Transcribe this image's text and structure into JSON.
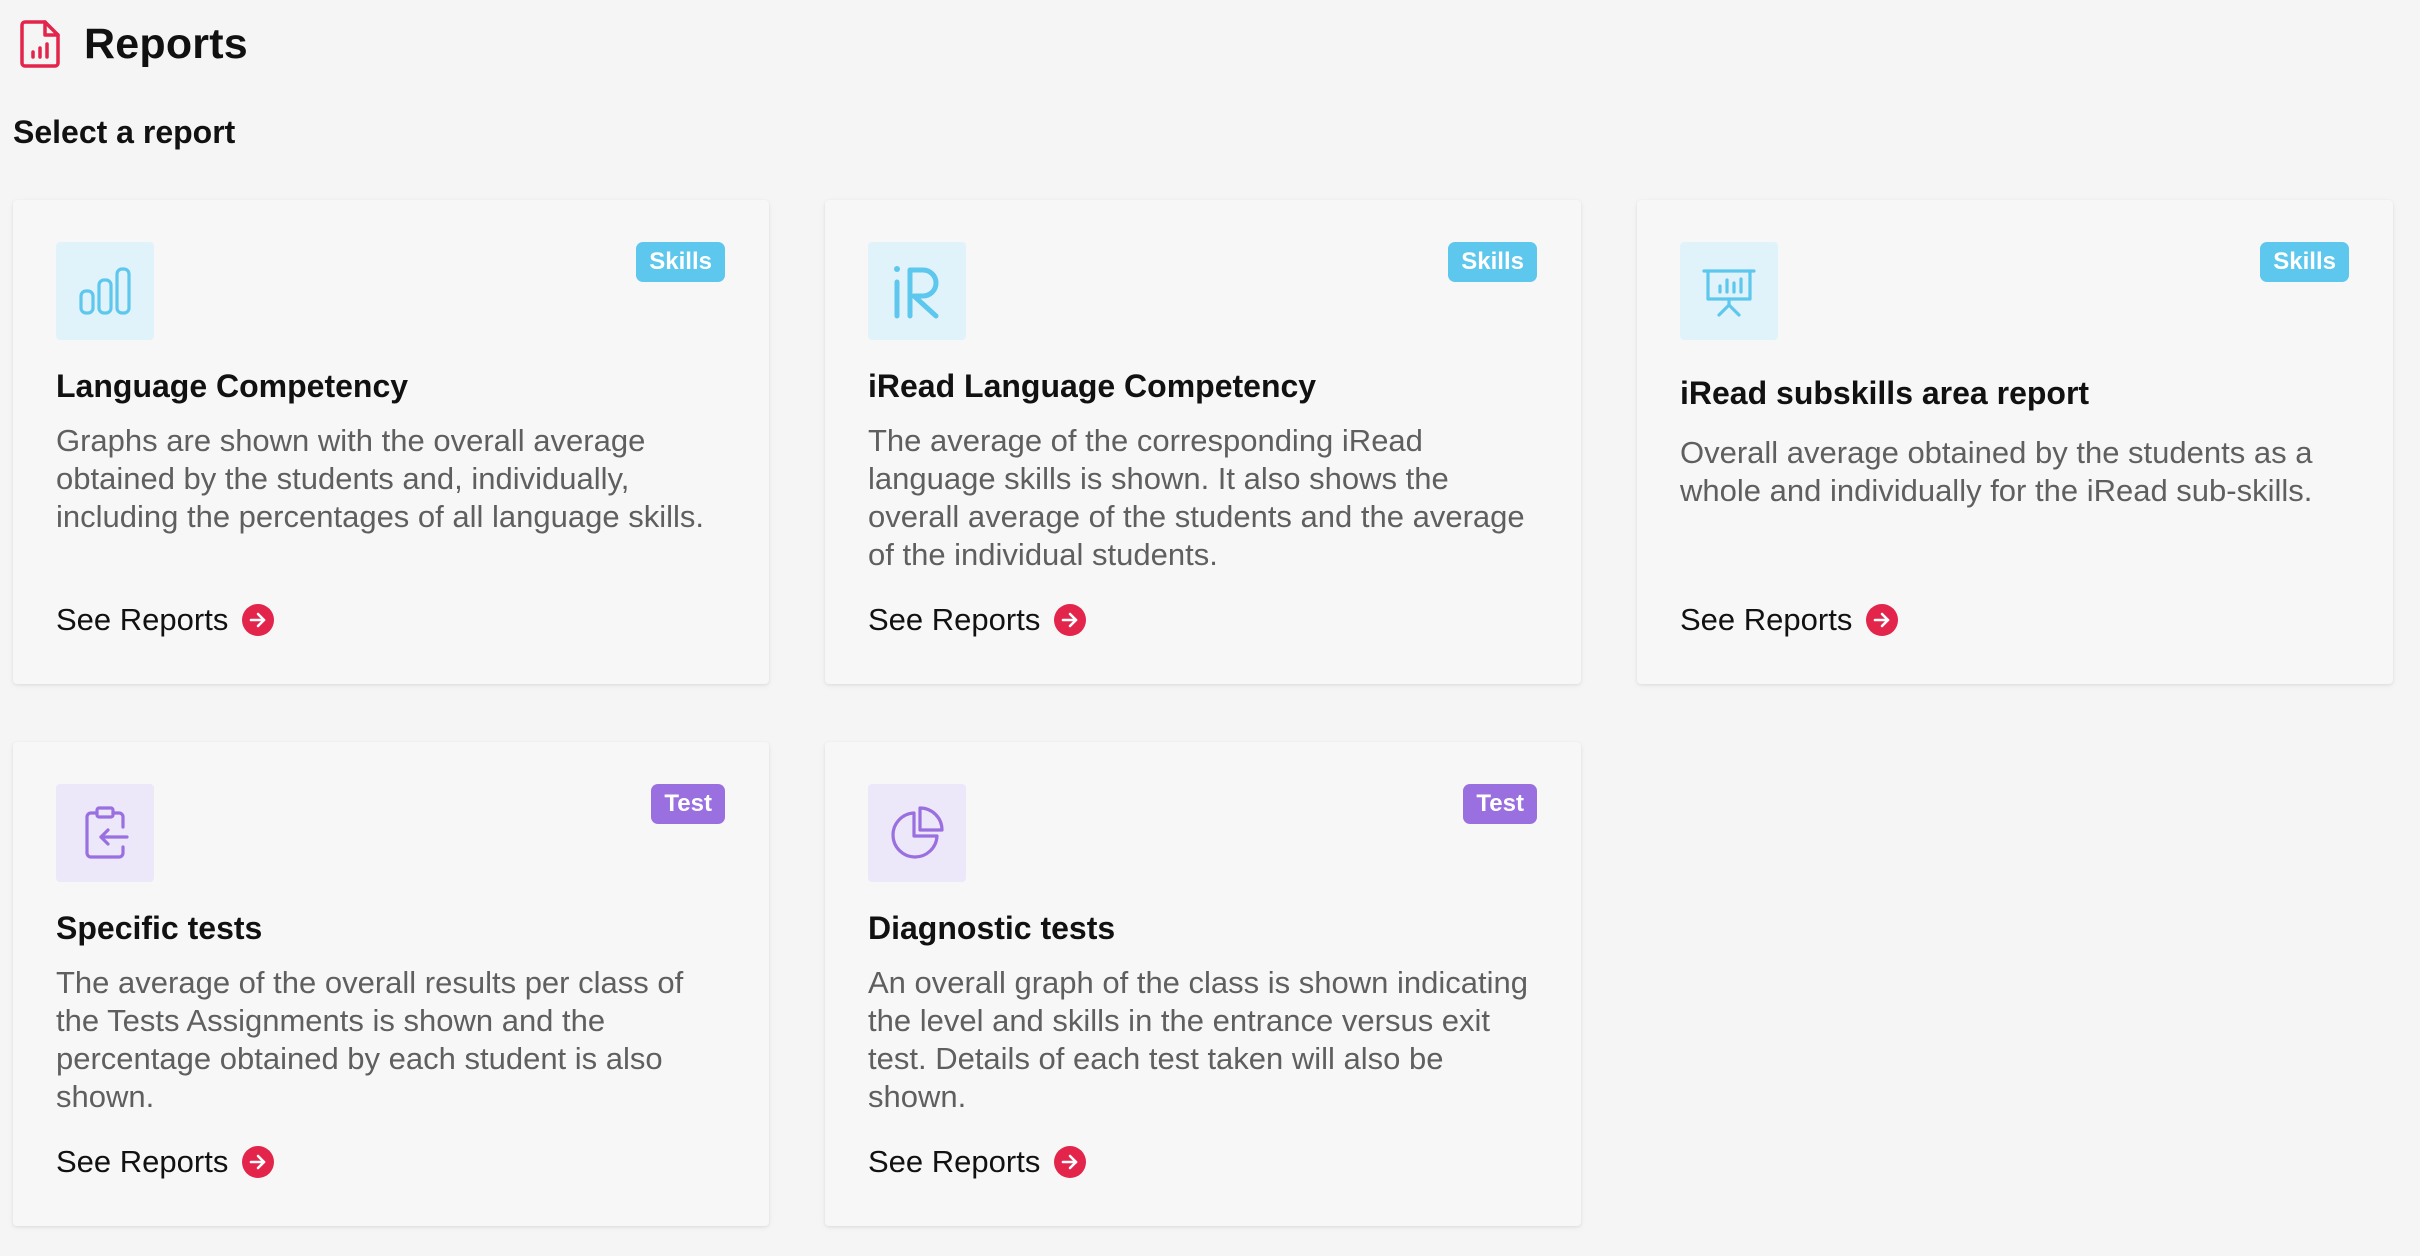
{
  "header": {
    "title": "Reports",
    "icon": "report-document-icon",
    "accent_color": "#e3244b"
  },
  "subtitle": "Select a report",
  "cards": [
    {
      "title": "Language Competency",
      "description": "Graphs are shown with the overall average obtained by the students and, individually, including the percentages of all language skills.",
      "badge": "Skills",
      "icon": "bar-chart-icon",
      "link": "See Reports"
    },
    {
      "title": "iRead Language Competency",
      "description": "The average of the corresponding iRead language skills is shown. It also shows the overall average of the students and the average of the individual students.",
      "badge": "Skills",
      "icon": "iread-logo-icon",
      "link": "See Reports"
    },
    {
      "title": "iRead subskills area report",
      "description": "Overall average obtained by the students as a whole and individually for the iRead sub-skills.",
      "badge": "Skills",
      "icon": "presentation-board-icon",
      "link": "See Reports"
    },
    {
      "title": "Specific tests",
      "description": "The average of the overall results per class of the Tests Assignments is shown and the percentage obtained by each student is also shown.",
      "badge": "Test",
      "icon": "clipboard-arrow-icon",
      "link": "See Reports"
    },
    {
      "title": "Diagnostic tests",
      "description": "An overall graph of the class is shown indicating the level and skills in the entrance versus exit test. Details of each test taken will also be shown.",
      "badge": "Test",
      "icon": "pie-chart-icon",
      "link": "See Reports"
    }
  ],
  "colors": {
    "skills_badge": "#5dc7ee",
    "test_badge": "#9a6fe0",
    "skills_icon": "#5dc7ee",
    "test_icon": "#9a6fe0",
    "link_arrow": "#e3244b"
  }
}
